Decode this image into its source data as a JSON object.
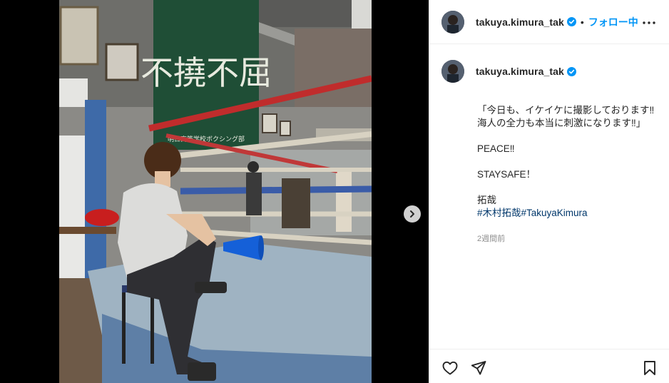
{
  "post": {
    "username": "takuya.kimura_tak",
    "verified": true,
    "separator": "•",
    "follow_label": "フォロー中",
    "more_icon": "more-horizontal-icon"
  },
  "caption": {
    "username": "takuya.kimura_tak",
    "text": "「今日も、イケイケに撮影しております‼\n海人の全力も本当に刺激になります‼」\n\nPEACE‼\n\nSTAYSAFE！\n\n拓哉",
    "hashtags": [
      "#木村拓哉",
      "#TakuyaKimura"
    ],
    "time_ago": "2週間前"
  },
  "media": {
    "banner_big_text": "不撓不屈",
    "banner_small_text": "明日高等学校ボクシング部",
    "next_icon": "chevron-right-icon"
  },
  "actions": {
    "like_icon": "heart-icon",
    "share_icon": "paper-plane-icon",
    "save_icon": "bookmark-icon"
  },
  "colors": {
    "link_blue": "#0095f6",
    "hashtag_blue": "#00376b",
    "verified_blue": "#0095f6",
    "muted": "#8e8e8e"
  }
}
